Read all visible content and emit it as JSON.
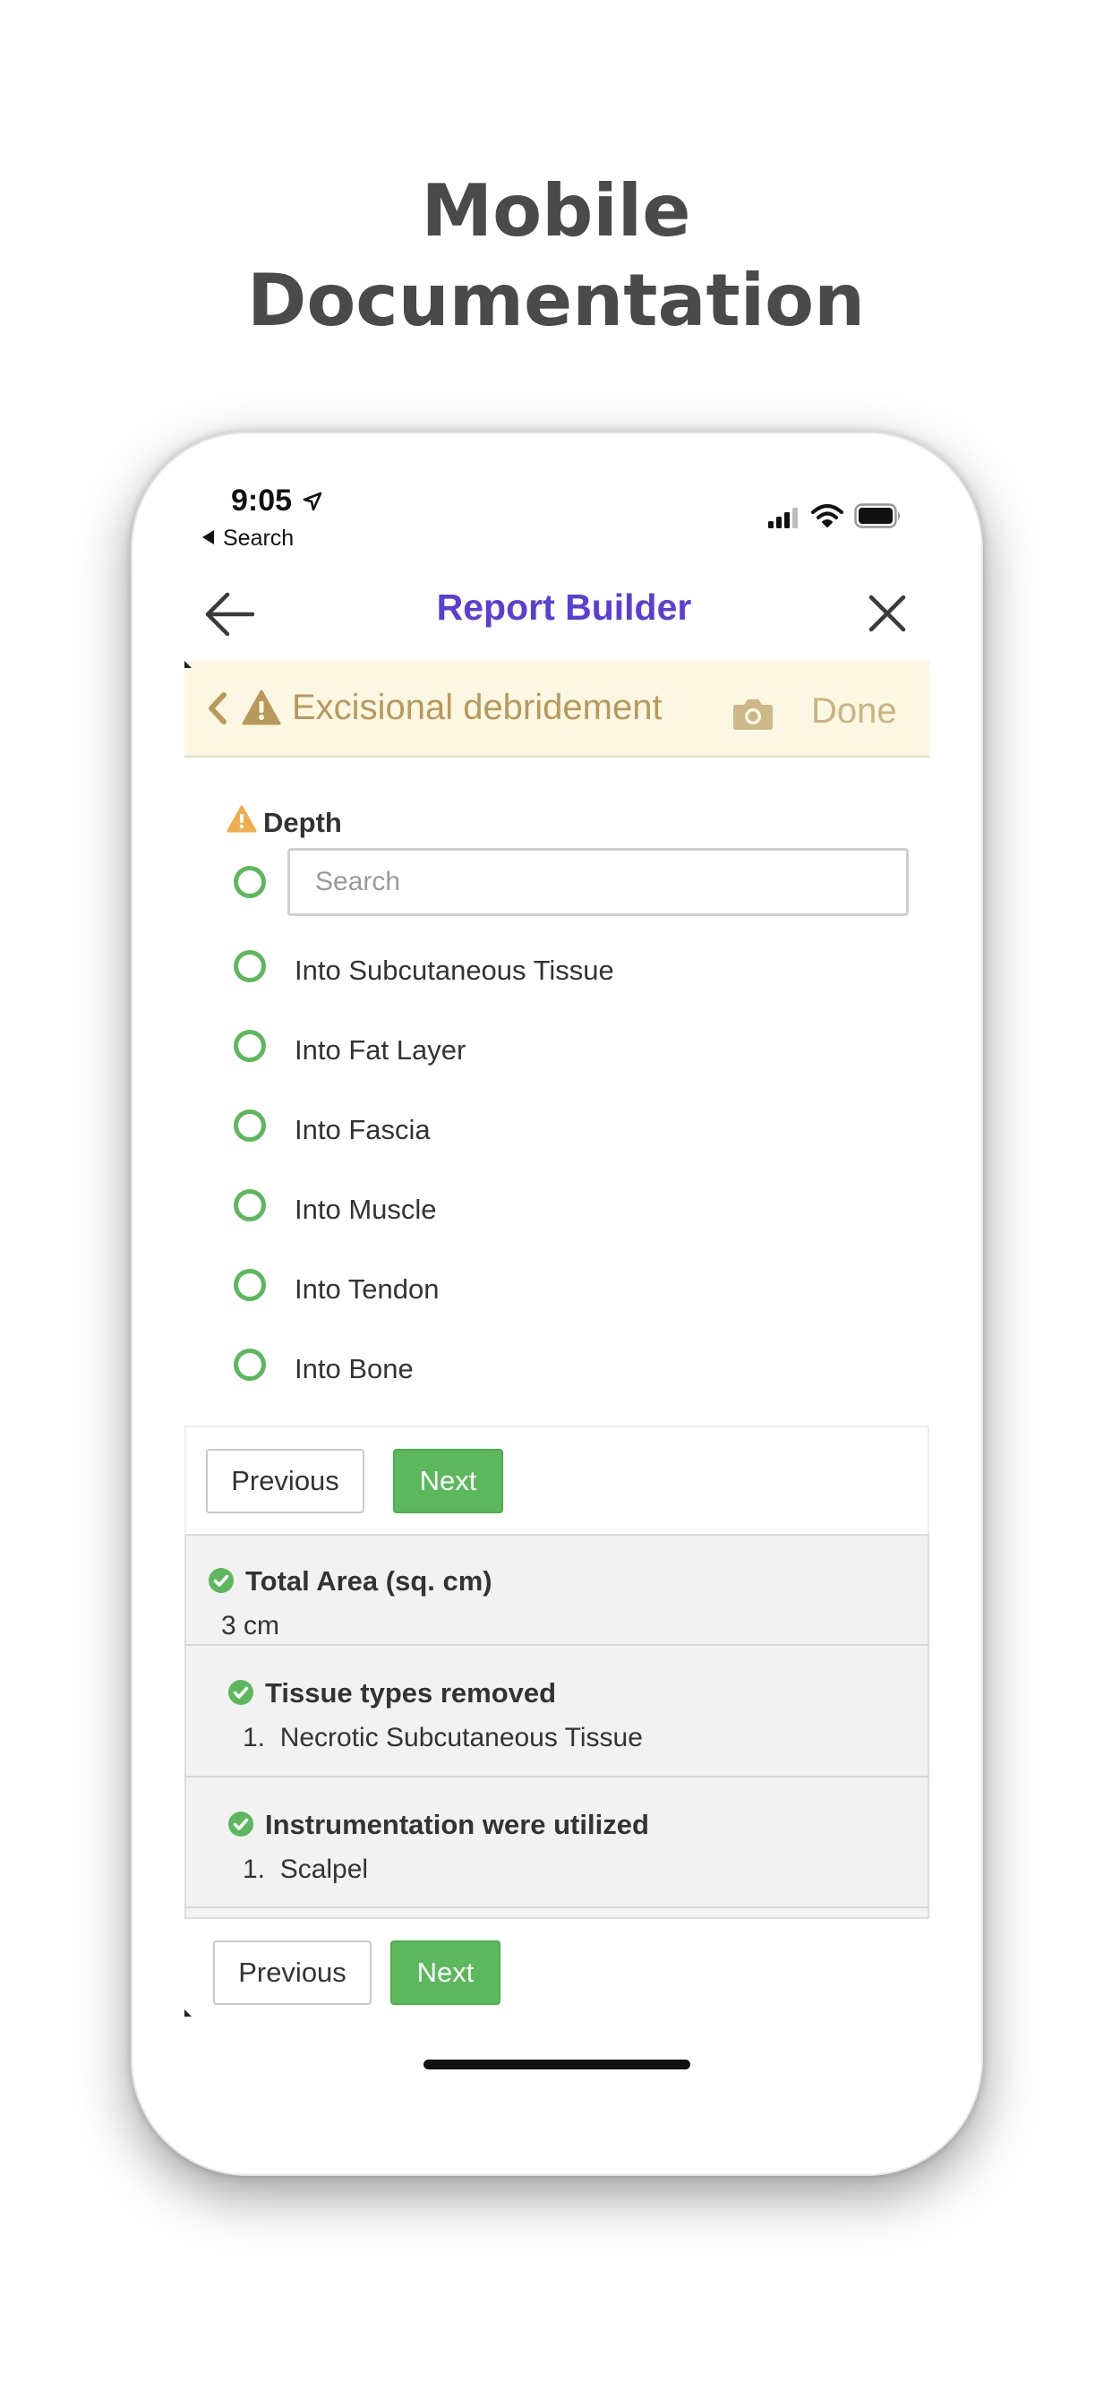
{
  "headline": {
    "line1": "Mobile",
    "line2": "Documentation"
  },
  "status_bar": {
    "time": "9:05",
    "back_app": "Search"
  },
  "nav": {
    "title": "Report Builder"
  },
  "section": {
    "title": "Excisional debridement",
    "done_label": "Done"
  },
  "question": {
    "label": "Depth",
    "search_placeholder": "Search",
    "options": [
      "Into Subcutaneous Tissue",
      "Into Fat Layer",
      "Into Fascia",
      "Into Muscle",
      "Into Tendon",
      "Into Bone"
    ]
  },
  "buttons": {
    "previous": "Previous",
    "next": "Next"
  },
  "summary": [
    {
      "title": "Total Area (sq. cm)",
      "value": "3 cm"
    },
    {
      "title": "Tissue types removed",
      "value": "1.  Necrotic Subcutaneous Tissue"
    },
    {
      "title": "Instrumentation were utilized",
      "value": "1.  Scalpel"
    }
  ],
  "colors": {
    "accent_title": "#5b3ed6",
    "success_green": "#5cb85c",
    "warning_amber": "#f0ad4e",
    "section_bg": "#fcf7e3"
  }
}
